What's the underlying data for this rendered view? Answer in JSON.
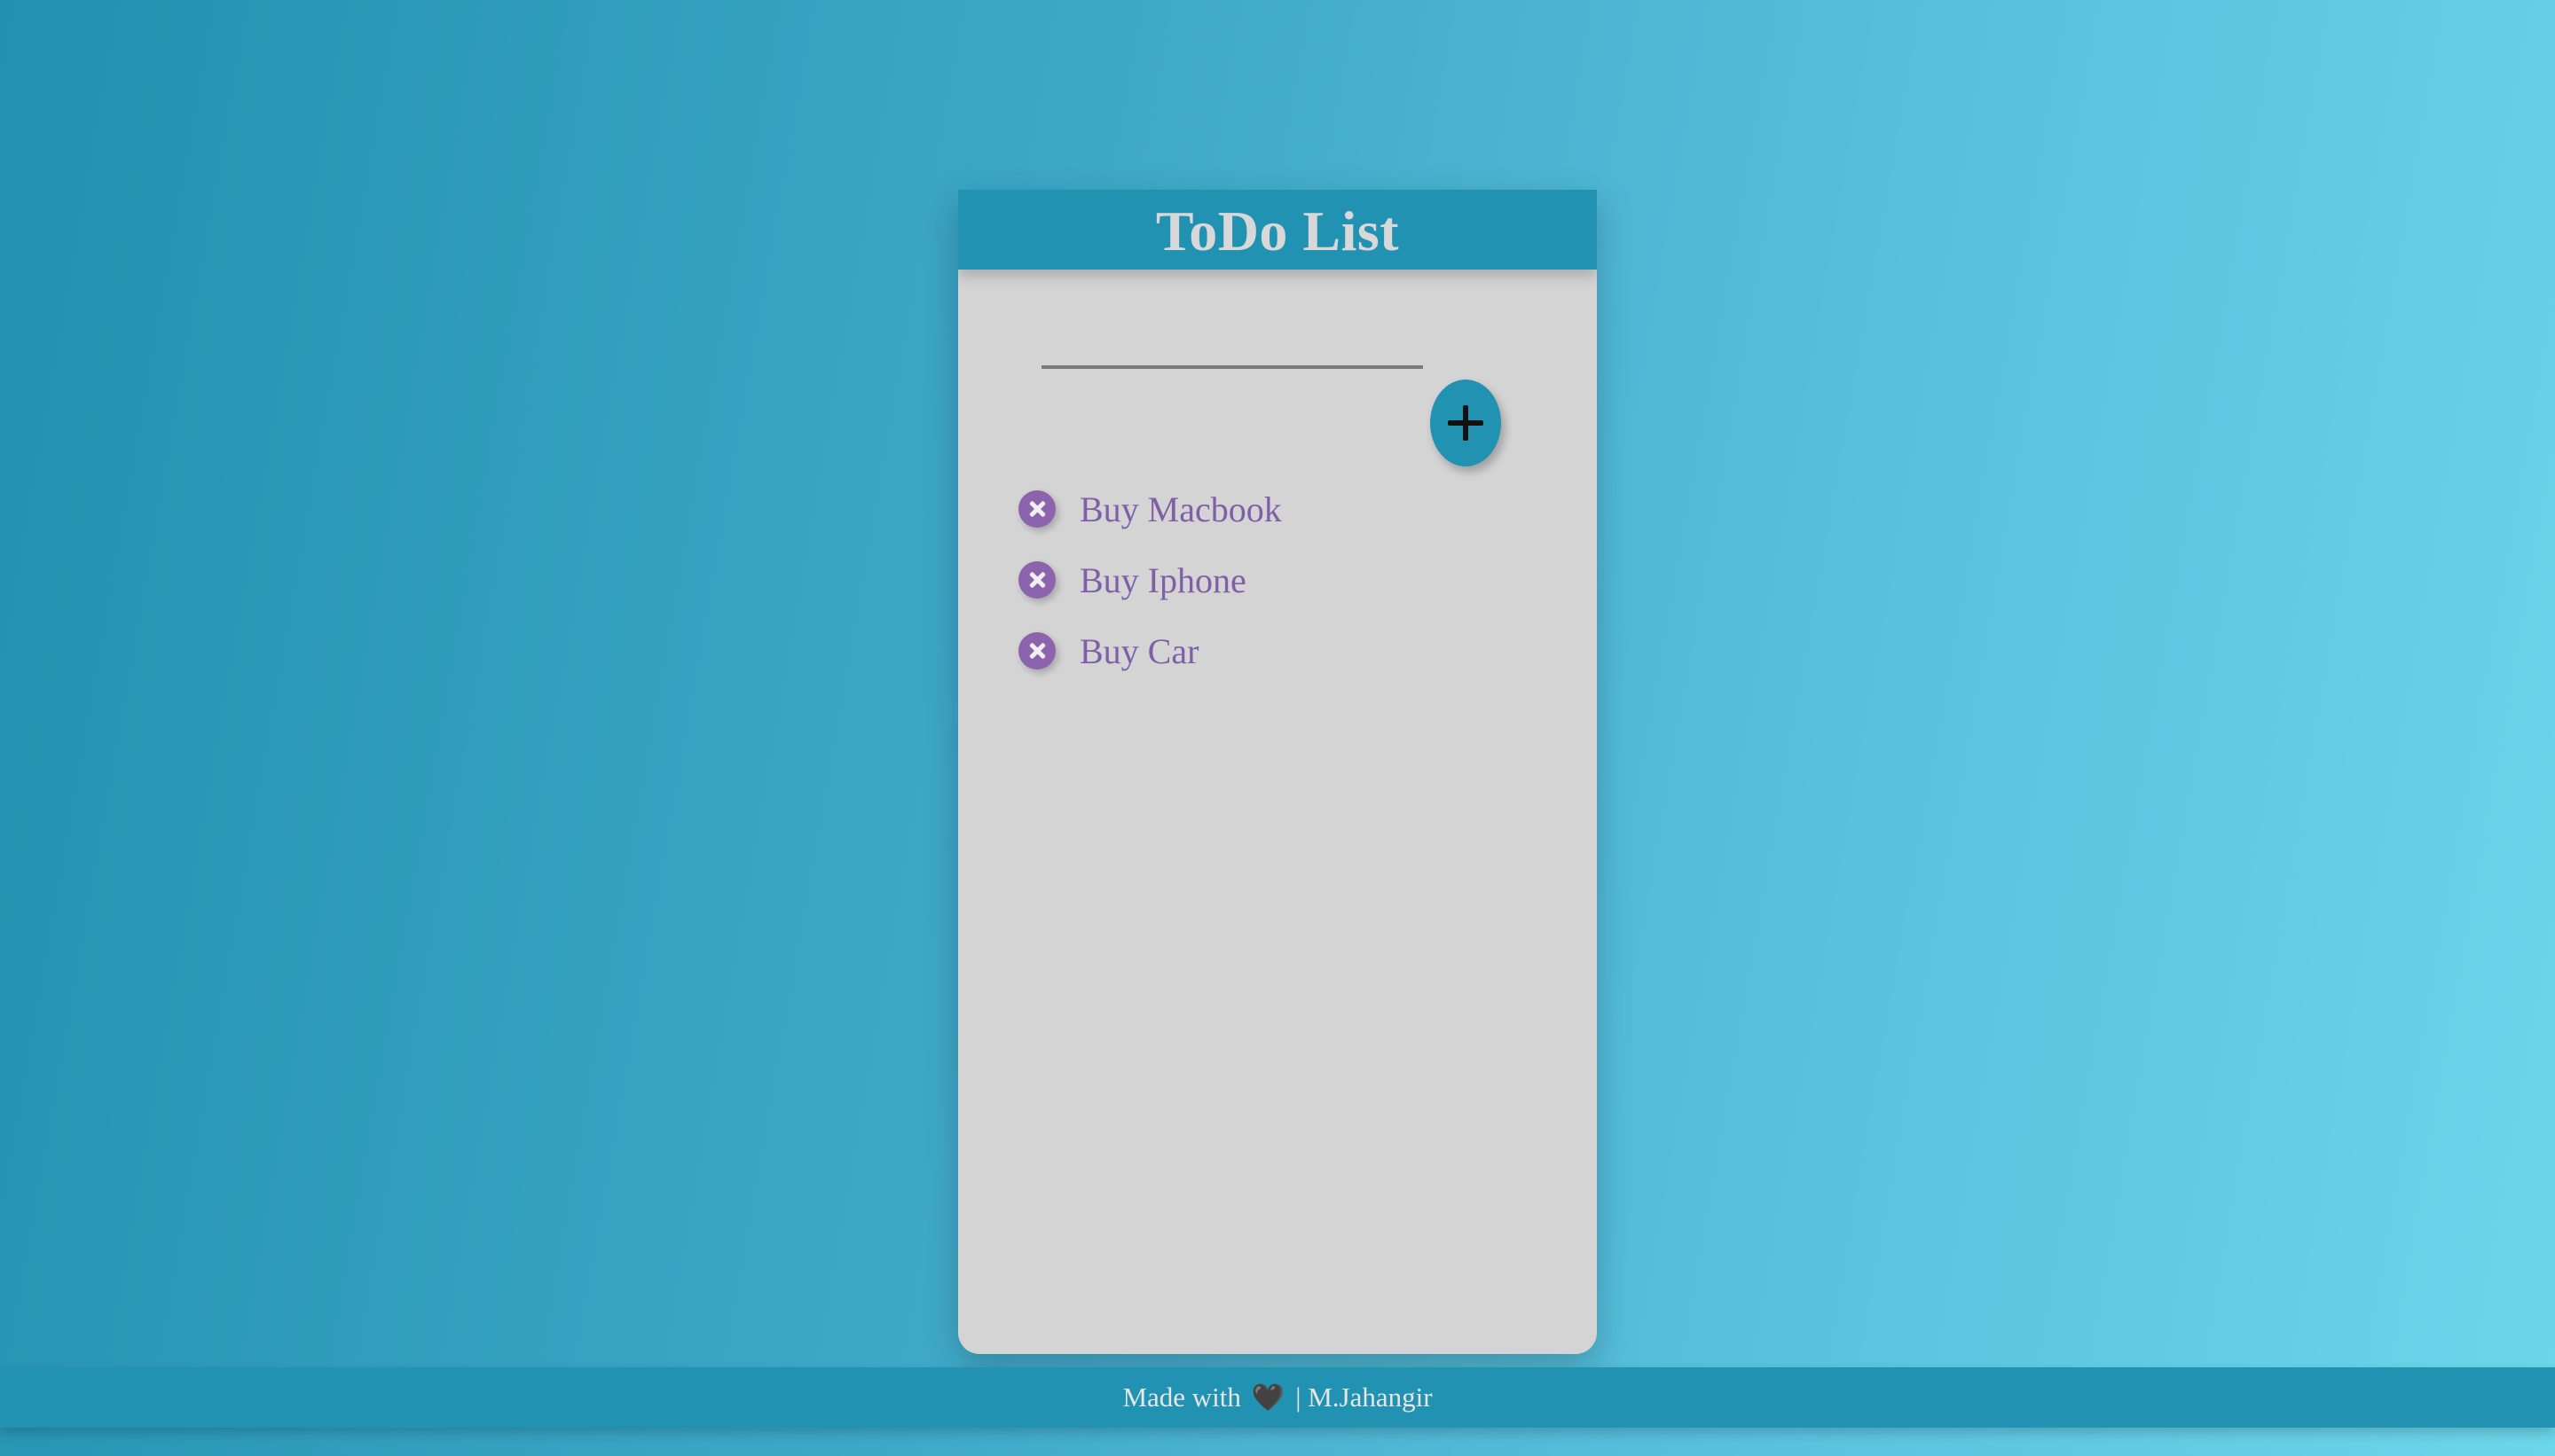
{
  "app": {
    "title": "ToDo List"
  },
  "input": {
    "value": "",
    "placeholder": "",
    "add_button_icon": "plus-icon"
  },
  "todos": [
    {
      "text": "Buy Macbook",
      "icon": "close-icon"
    },
    {
      "text": "Buy Iphone",
      "icon": "close-icon"
    },
    {
      "text": "Buy Car",
      "icon": "close-icon"
    }
  ],
  "footer": {
    "prefix": "Made with",
    "heart": "🖤",
    "suffix": "| M.Jahangir"
  },
  "colors": {
    "accent": "#2292b2",
    "card_background": "#d4d4d4",
    "todo_text": "#7f5fa6",
    "delete_icon": "#8b64ad"
  }
}
